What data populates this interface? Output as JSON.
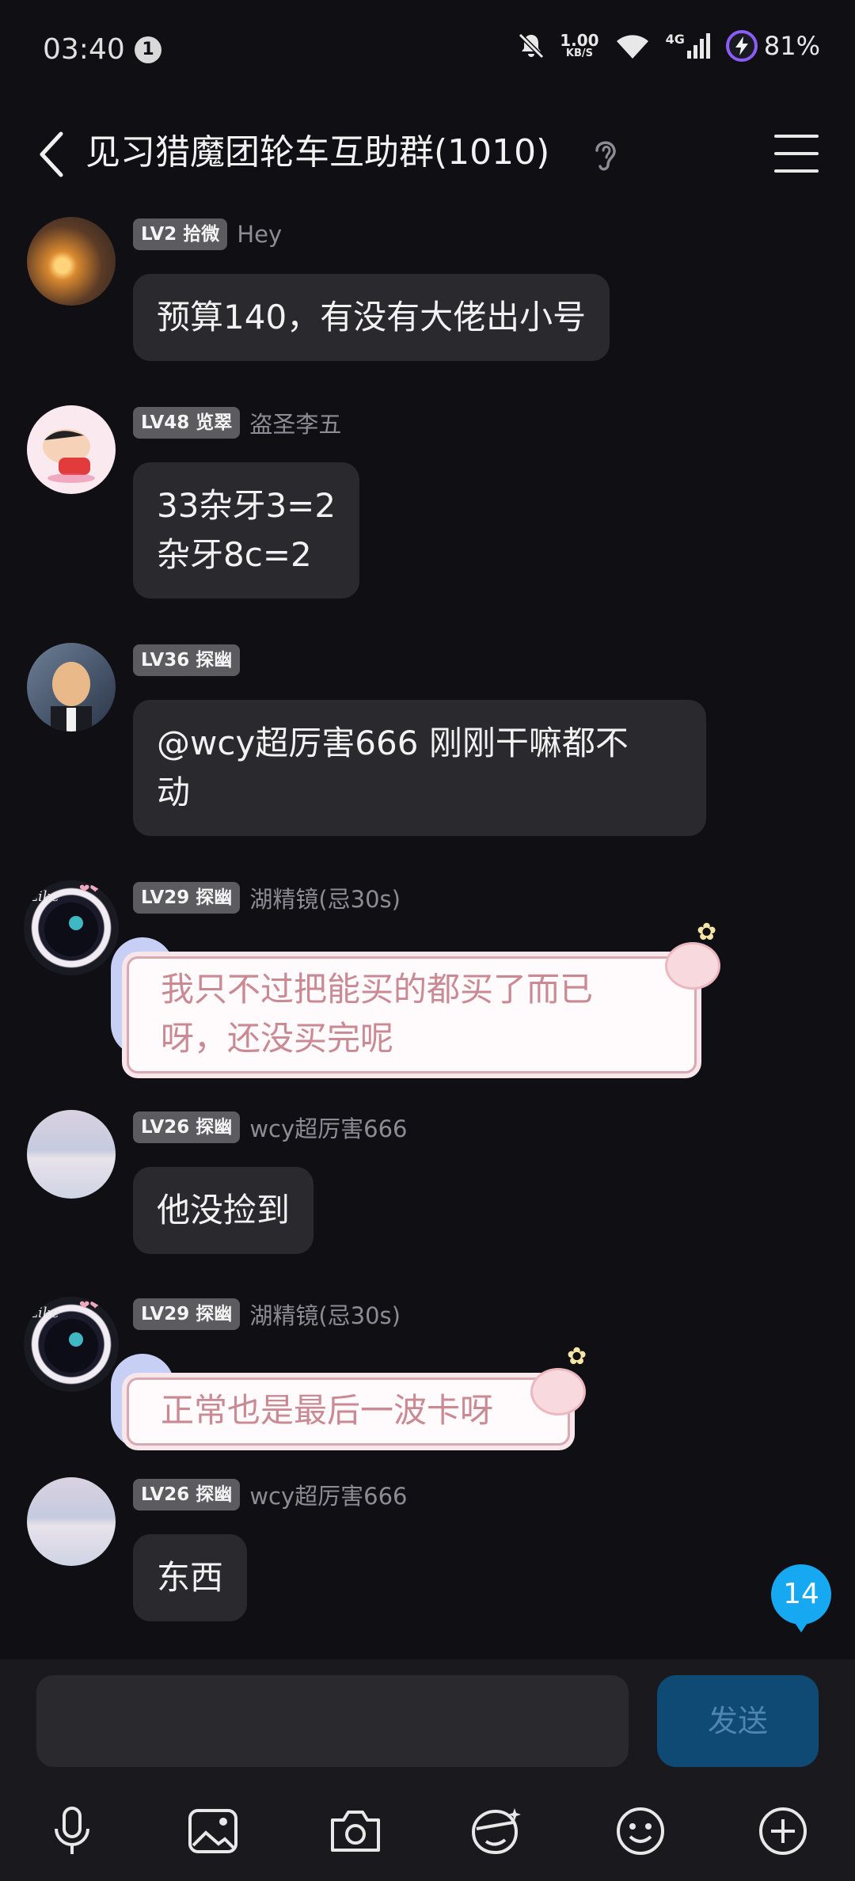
{
  "status_bar": {
    "time": "03:40",
    "notification_count": "1",
    "net_speed_value": "1.00",
    "net_speed_unit": "KB/S",
    "network_type": "4G",
    "battery_percent": "81%"
  },
  "header": {
    "title": "见习猎魔团轮车互助群(1010)"
  },
  "messages": [
    {
      "level": "LV2 拾微",
      "nickname": "Hey",
      "text": "预算140，有没有大佬出小号"
    },
    {
      "level": "LV48 览翠",
      "nickname": "盗圣李五",
      "text": "33杂牙3=2\n杂牙8c=2"
    },
    {
      "level": "LV36 探幽",
      "nickname": "",
      "text": "@wcy超厉害666 刚刚干嘛都不\n动"
    },
    {
      "level": "LV29 探幽",
      "nickname": "湖精镜(忌30s)",
      "text": "我只不过把能买的都买了而已\n呀，还没买完呢"
    },
    {
      "level": "LV26 探幽",
      "nickname": "wcy超厉害666",
      "text": "他没捡到"
    },
    {
      "level": "LV29 探幽",
      "nickname": "湖精镜(忌30s)",
      "text": "正常也是最后一波卡呀"
    },
    {
      "level": "LV26 探幽",
      "nickname": "wcy超厉害666",
      "text": "东西"
    }
  ],
  "unread_count": "14",
  "composer": {
    "input_value": "",
    "send_label": "发送"
  },
  "icons": {
    "back": "chevron-left-icon",
    "ear": "ear-icon",
    "menu": "menu-icon",
    "toolbar": [
      "microphone-icon",
      "image-icon",
      "camera-icon",
      "sticker-icon",
      "emoji-icon",
      "plus-icon"
    ]
  }
}
